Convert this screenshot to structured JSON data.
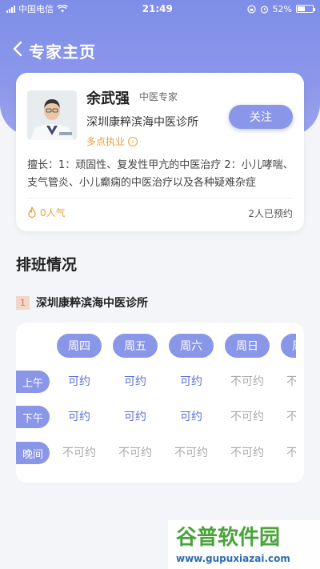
{
  "status_bar": {
    "carrier": "中国电信",
    "time": "21:49",
    "battery": "52%"
  },
  "nav": {
    "title": "专家主页"
  },
  "doctor": {
    "name": "余武强",
    "title": "中医专家",
    "hospital": "深圳康粹滨海中医诊所",
    "multi_site_label": "多点执业",
    "follow_label": "关注",
    "specialty": "擅长：1：顽固性、复发性甲亢的中医治疗 2：小儿哮喘、支气管炎、小儿癫痫的中医治疗以及各种疑难杂症",
    "popularity": "0人气",
    "booked": "2人已预约"
  },
  "schedule": {
    "section_title": "排班情况",
    "clinic_index": "1",
    "clinic_name": "深圳康粹滨海中医诊所",
    "days": [
      "周四",
      "周五",
      "周六",
      "周日",
      "周一"
    ],
    "periods": [
      {
        "label": "上午",
        "slots": [
          "可约",
          "可约",
          "可约",
          "不可约",
          "不可约"
        ]
      },
      {
        "label": "下午",
        "slots": [
          "可约",
          "可约",
          "可约",
          "不可约",
          "不可约"
        ]
      },
      {
        "label": "晚间",
        "slots": [
          "不可约",
          "不可约",
          "不可约",
          "不可约",
          "不可约"
        ]
      }
    ],
    "available_text": "可约",
    "accent_color": "#8a96e8"
  },
  "watermark": {
    "brand": "谷普软件园",
    "url": "www.gupuxiazai.com"
  }
}
